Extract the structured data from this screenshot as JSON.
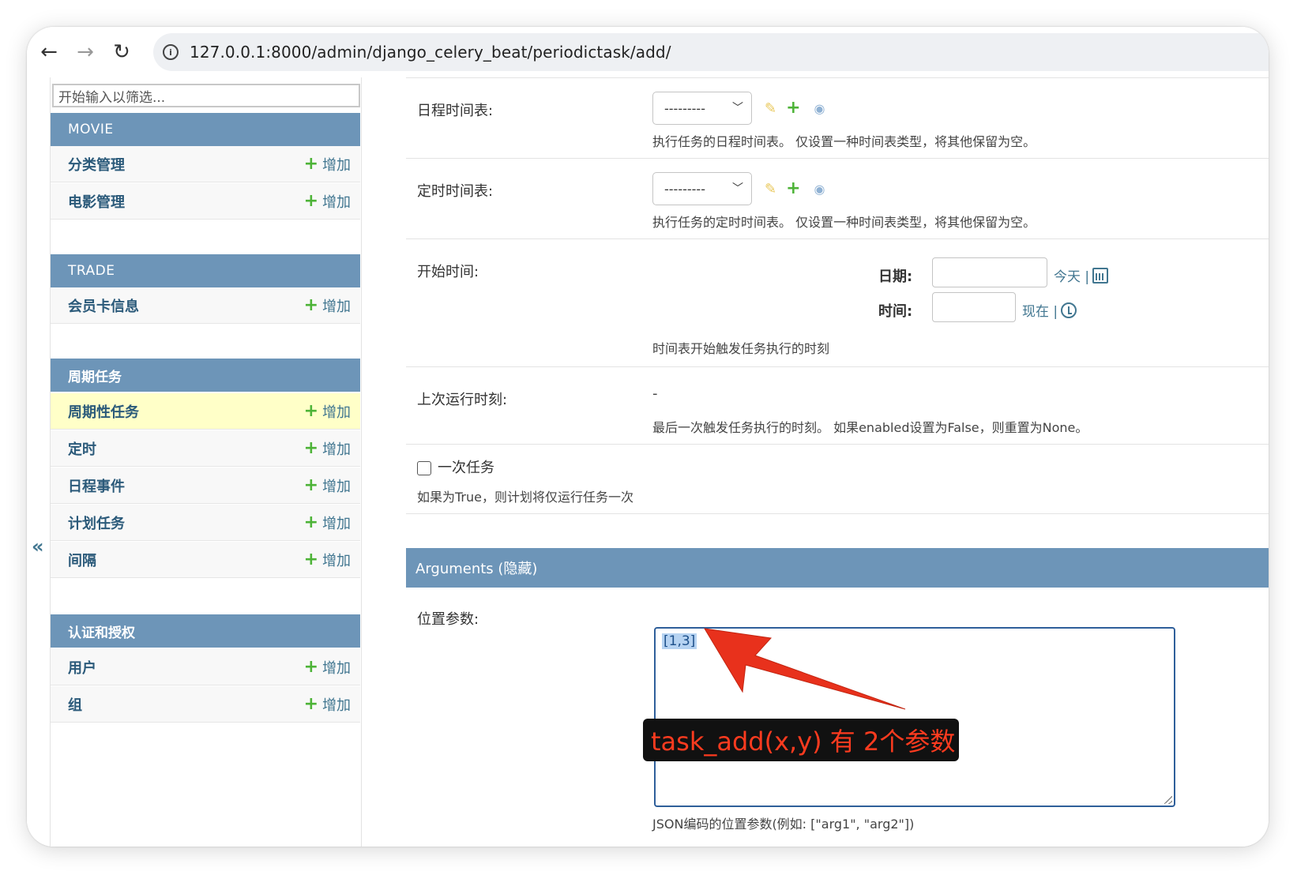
{
  "browser": {
    "url": "127.0.0.1:8000/admin/django_celery_beat/periodictask/add/"
  },
  "sidebar": {
    "filter_placeholder": "开始输入以筛选...",
    "collapse_label": "«",
    "add_label": "增加",
    "sections": [
      {
        "title": "MOVIE",
        "items": [
          "分类管理",
          "电影管理"
        ]
      },
      {
        "title": "TRADE",
        "items": [
          "会员卡信息"
        ]
      },
      {
        "title": "周期任务",
        "items": [
          "周期性任务",
          "定时",
          "日程事件",
          "计划任务",
          "间隔"
        ]
      },
      {
        "title": "认证和授权",
        "items": [
          "用户",
          "组"
        ]
      }
    ],
    "active_item": "周期性任务"
  },
  "form": {
    "crontab": {
      "label": "日程时间表:",
      "value": "---------",
      "help": "执行任务的日程时间表。 仅设置一种时间表类型，将其他保留为空。"
    },
    "clocked": {
      "label": "定时时间表:",
      "value": "---------",
      "help": "执行任务的定时时间表。 仅设置一种时间表类型，将其他保留为空。"
    },
    "start_time": {
      "label": "开始时间:",
      "date_label": "日期:",
      "today_link": "今天 |",
      "time_label": "时间:",
      "now_link": "现在 |",
      "help": "时间表开始触发任务执行的时刻"
    },
    "last_run": {
      "label": "上次运行时刻:",
      "value": "-",
      "help": "最后一次触发任务执行的时刻。 如果enabled设置为False，则重置为None。"
    },
    "one_off": {
      "label": "一次任务",
      "help": "如果为True，则计划将仅运行任务一次"
    },
    "arguments_header": "Arguments (隐藏)",
    "args": {
      "label": "位置参数:",
      "value": "[1,3]",
      "help": "JSON编码的位置参数(例如: [\"arg1\", \"arg2\"])"
    }
  },
  "annotation": {
    "text": "task_add(x,y) 有 2个参数",
    "color": "#e8311c"
  },
  "colors": {
    "module_header": "#6d95b8",
    "link": "#417690",
    "active_row": "#ffffc8",
    "add_plus": "#4db337"
  }
}
